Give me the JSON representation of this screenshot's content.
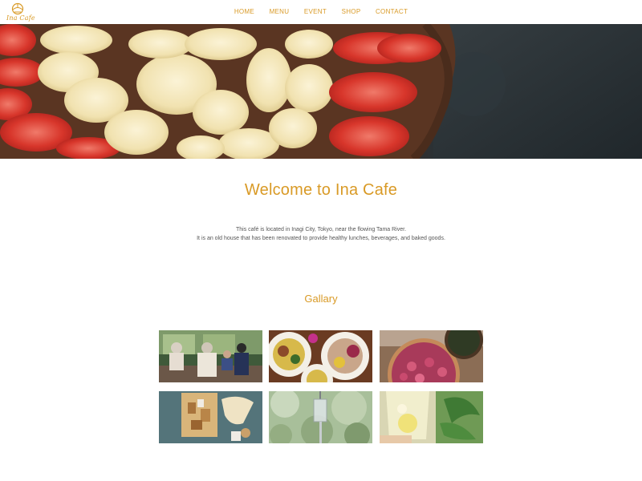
{
  "site": {
    "logo_text": "Ina Cafe",
    "brand_color": "#d99a26"
  },
  "nav": {
    "items": [
      "HOME",
      "MENU",
      "EVENT",
      "SHOP",
      "CONTACT"
    ]
  },
  "hero": {
    "image": "banana-strawberry-tart-photo"
  },
  "welcome": {
    "title": "Welcome to Ina Cafe",
    "line1": "This café is located in Inagi City, Tokyo, near the flowing Tama River.",
    "line2": "It is an old house that has been renovated to provide healthy lunches, beverages, and baked goods."
  },
  "gallery": {
    "title": "Gallary",
    "photos": [
      "people-at-table-by-window-photo",
      "curry-plates-photo",
      "pink-tart-photo",
      "baked-goods-bag-photo",
      "glass-lantern-garden-photo",
      "lemon-drink-photo"
    ]
  }
}
